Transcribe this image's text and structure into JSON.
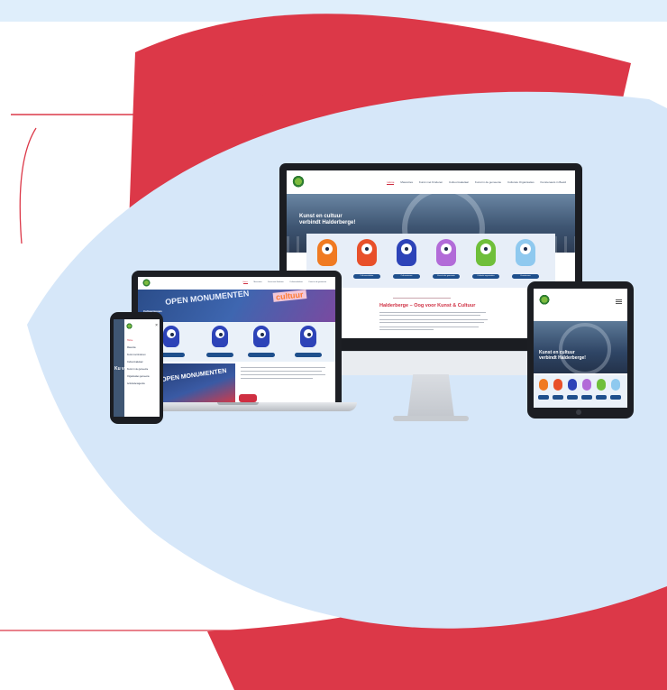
{
  "colors": {
    "brand_red": "#cf2f42",
    "light_blue": "#d6e7f9",
    "navy": "#1e4f8c"
  },
  "desktop": {
    "nav_links": [
      "Home",
      "Mascottes",
      "Kunst met Kinderen",
      "Cultuurmakelaar",
      "Kunst in de gemeente",
      "Culturele Organisaties",
      "Kunstenaars in Beeld"
    ],
    "hero_title_line1": "Kunst en cultuur",
    "hero_title_line2": "verbindt Halderberge!",
    "mascot_buttons": [
      "Mascotte",
      "Cultuurmakelaar",
      "Cultuurnieuws",
      "Kunst in de gemeente",
      "Culturele organisaties",
      "Kunstenaars"
    ],
    "section_heading": "Halderberge – Oog voor Kunst & Cultuur"
  },
  "laptop": {
    "hero_label": "Cultuurnieuws",
    "banner_left": "OPEN MONUMENTEN",
    "banner_right": "cultuur",
    "bottom_banner": "OPEN MONUMENTEN"
  },
  "tablet": {
    "hero_title_line1": "Kunst en cultuur",
    "hero_title_line2": "verbindt Halderberge!"
  },
  "phone": {
    "menu_items": [
      "Home",
      "Mascotte",
      "Kunst met kinderen",
      "Cultuurmakelaar",
      "Kunst in de gemeente",
      "Organisaties gemeente",
      "Activiteitenagenda"
    ],
    "behind_text": "Ku ve Ha"
  }
}
